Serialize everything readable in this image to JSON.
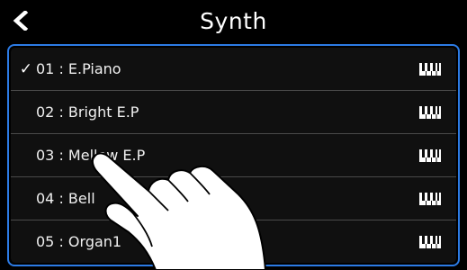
{
  "header": {
    "title": "Synth"
  },
  "list": {
    "items": [
      {
        "label": "01 : E.Piano",
        "checked": true
      },
      {
        "label": "02 : Bright E.P",
        "checked": false
      },
      {
        "label": "03 : Mellow E.P",
        "checked": false
      },
      {
        "label": "04 : Bell",
        "checked": false
      },
      {
        "label": "05 : Organ1",
        "checked": false
      }
    ]
  },
  "icons": {
    "back": "chevron-left-icon",
    "check": "✓",
    "instrument": "keyboard-icon"
  },
  "colors": {
    "accent": "#2c7be5",
    "background": "#000000"
  }
}
